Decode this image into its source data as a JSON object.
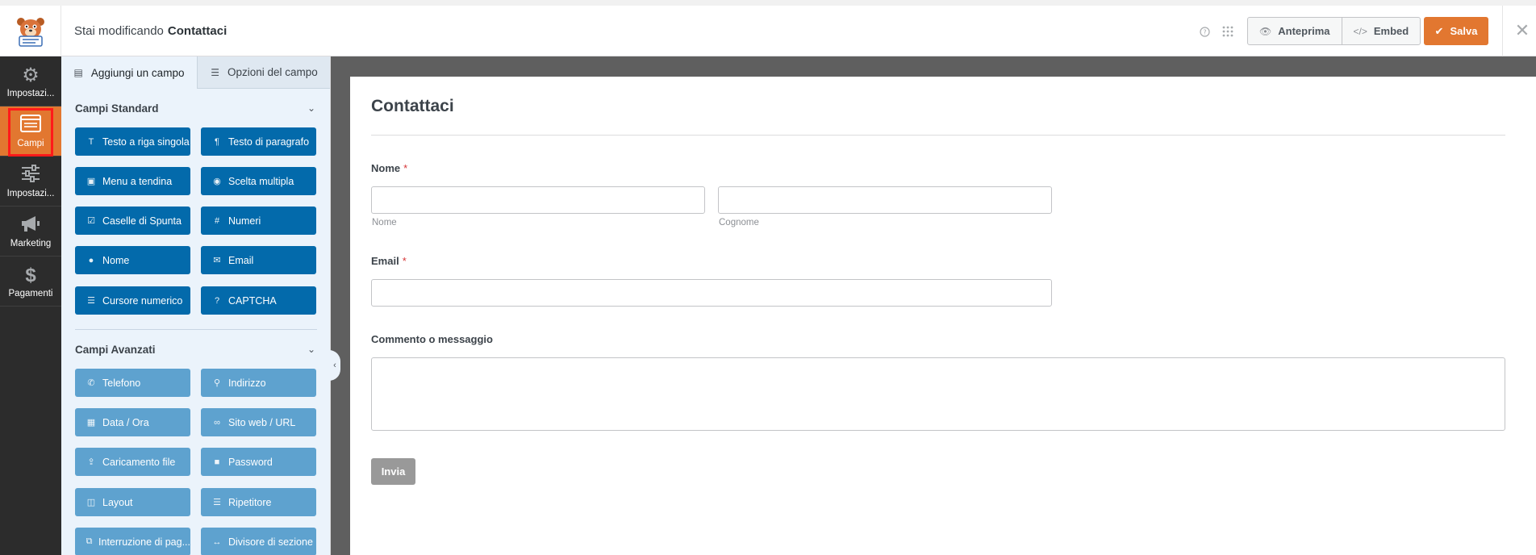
{
  "header": {
    "title_prefix": "Stai modificando",
    "form_name": "Contattaci",
    "preview_label": "Anteprima",
    "embed_label": "Embed",
    "save_label": "Salva"
  },
  "colors": {
    "accent": "#e27730",
    "standard_button": "#036aab",
    "advanced_button": "#5ea2cf",
    "sidebar_bg": "#2c2c2c"
  },
  "leftnav": {
    "items": [
      {
        "label": "Impostazi...",
        "icon": "gear-icon"
      },
      {
        "label": "Campi",
        "icon": "fields-list-icon"
      },
      {
        "label": "Impostazi...",
        "icon": "sliders-icon"
      },
      {
        "label": "Marketing",
        "icon": "megaphone-icon"
      },
      {
        "label": "Pagamenti",
        "icon": "dollar-icon"
      }
    ]
  },
  "panel": {
    "tabs": [
      {
        "label": "Aggiungi un campo",
        "icon": "list-icon"
      },
      {
        "label": "Opzioni del campo",
        "icon": "sliders-icon"
      }
    ],
    "standard_title": "Campi Standard",
    "standard_fields": [
      {
        "label": "Testo a riga singola",
        "icon": "text-icon"
      },
      {
        "label": "Testo di paragrafo",
        "icon": "paragraph-icon"
      },
      {
        "label": "Menu a tendina",
        "icon": "dropdown-icon"
      },
      {
        "label": "Scelta multipla",
        "icon": "radio-icon"
      },
      {
        "label": "Caselle di Spunta",
        "icon": "checkbox-icon"
      },
      {
        "label": "Numeri",
        "icon": "hash-icon"
      },
      {
        "label": "Nome",
        "icon": "user-icon"
      },
      {
        "label": "Email",
        "icon": "envelope-icon"
      },
      {
        "label": "Cursore numerico",
        "icon": "slider-icon"
      },
      {
        "label": "CAPTCHA",
        "icon": "question-icon"
      }
    ],
    "advanced_title": "Campi Avanzati",
    "advanced_fields": [
      {
        "label": "Telefono",
        "icon": "phone-icon"
      },
      {
        "label": "Indirizzo",
        "icon": "map-pin-icon"
      },
      {
        "label": "Data / Ora",
        "icon": "calendar-icon"
      },
      {
        "label": "Sito web / URL",
        "icon": "link-icon"
      },
      {
        "label": "Caricamento file",
        "icon": "upload-icon"
      },
      {
        "label": "Password",
        "icon": "lock-icon"
      },
      {
        "label": "Layout",
        "icon": "layout-icon"
      },
      {
        "label": "Ripetitore",
        "icon": "repeater-icon"
      },
      {
        "label": "Interruzione di pag...",
        "icon": "page-break-icon"
      },
      {
        "label": "Divisore di sezione",
        "icon": "divider-icon"
      }
    ]
  },
  "form": {
    "title": "Contattaci",
    "name_label": "Nome",
    "name_first_sublabel": "Nome",
    "name_last_sublabel": "Cognome",
    "email_label": "Email",
    "comment_label": "Commento o messaggio",
    "required_mark": "*",
    "submit_label": "Invia"
  }
}
